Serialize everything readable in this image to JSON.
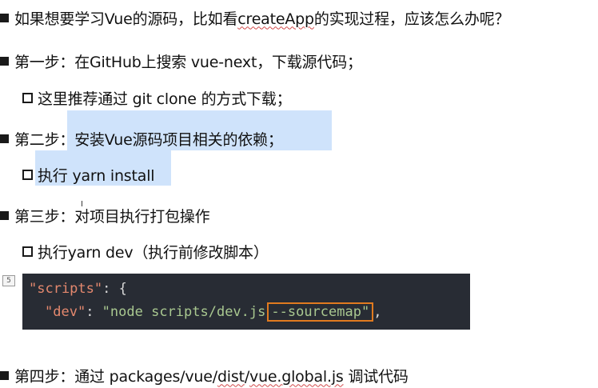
{
  "slide": {
    "intro": {
      "prefix": "如果想要学习Vue的源码，比如看",
      "spell_word": "createApp",
      "suffix": "的实现过程，应该怎么办呢？"
    },
    "step1": "第一步：在GitHub上搜索 vue-next，下载源代码；",
    "step1_sub": "这里推荐通过 git clone 的方式下载；",
    "step2": "第二步：安装Vue源码项目相关的依赖；",
    "step2_sub": "执行 yarn install",
    "step3": "第三步：对项目执行打包操作",
    "step3_sub": "执行yarn dev（执行前修改脚本）",
    "code": {
      "line1_key": "\"scripts\"",
      "line1_punc": ": {",
      "line2_key": "\"dev\"",
      "line2_punc": ": ",
      "line2_str": "\"node scripts/dev.js",
      "line2_boxed": "--sourcemap\"",
      "line2_tail": ","
    },
    "step4": {
      "prefix": "第四步：通过 ",
      "path_a": "packages/vue/",
      "path_b": "dist",
      "path_c": "/",
      "path_d": "vue.global.js",
      "suffix": " 调试代码"
    },
    "page_badge": "5",
    "cursor_glyph": "I"
  },
  "colors": {
    "highlight": "#cfe3fb",
    "code_bg": "#282c34",
    "code_key": "#e4886e",
    "code_string": "#a9c890",
    "box_outline": "#e07a1f"
  }
}
